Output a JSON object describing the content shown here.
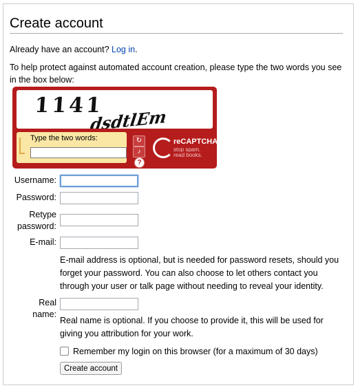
{
  "page": {
    "title": "Create account",
    "have_account_text": "Already have an account?",
    "login_link": "Log in",
    "login_period": ".",
    "captcha_instructions": "To help protect against automated account creation, please type the two words you see in the box below:"
  },
  "captcha": {
    "word1": "1141",
    "word2": "dsdtlEm",
    "input_label": "Type the two words:",
    "input_value": "",
    "refresh_icon": "refresh-icon",
    "audio_icon": "audio-icon",
    "help_icon": "help-icon",
    "logo_brand": "reCAPTCHA™",
    "logo_tag_1": "stop spam.",
    "logo_tag_2": "read books."
  },
  "form": {
    "username_label": "Username:",
    "username_value": "",
    "password_label": "Password:",
    "password_value": "",
    "retype_label_1": "Retype",
    "retype_label_2": "password:",
    "retype_value": "",
    "email_label": "E-mail:",
    "email_value": "",
    "email_help": "E-mail address is optional, but is needed for password resets, should you forget your password. You can also choose to let others contact you through your user or talk page without needing to reveal your identity.",
    "realname_label_1": "Real",
    "realname_label_2": "name:",
    "realname_value": "",
    "realname_help": "Real name is optional. If you choose to provide it, this will be used for giving you attribution for your work.",
    "remember_label": "Remember my login on this browser (for a maximum of 30 days)",
    "remember_checked": false,
    "submit_label": "Create account"
  }
}
